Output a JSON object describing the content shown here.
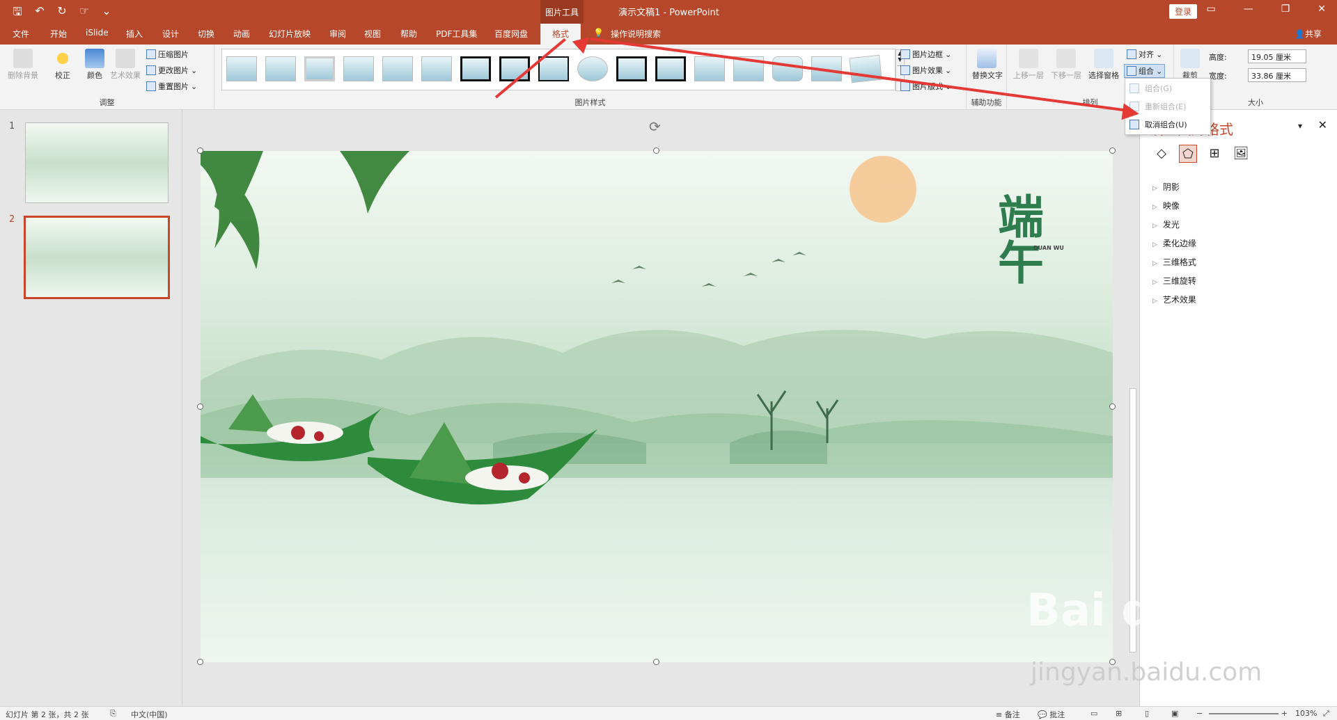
{
  "titlebar": {
    "context_group": "图片工具",
    "doc_title": "演示文稿1 - PowerPoint",
    "login": "登录",
    "qat_icons": [
      "save-icon",
      "undo-icon",
      "redo-icon",
      "touch-mode-icon",
      "customize-icon"
    ]
  },
  "tabs": [
    "文件",
    "开始",
    "iSlide",
    "插入",
    "设计",
    "切换",
    "动画",
    "幻灯片放映",
    "审阅",
    "视图",
    "帮助",
    "PDF工具集",
    "百度网盘",
    "格式"
  ],
  "active_tab": "格式",
  "search": "操作说明搜索",
  "share": "共享",
  "ribbon": {
    "adjust": {
      "remove_bg": "删除背景",
      "correct": "校正",
      "color": "颜色",
      "art": "艺术效果",
      "compress": "压缩图片",
      "change": "更改图片",
      "reset": "重置图片",
      "label": "调整"
    },
    "styles": {
      "label": "图片样式",
      "border": "图片边框",
      "effects": "图片效果",
      "layout": "图片版式"
    },
    "accessibility": {
      "alt_text": "替换文字",
      "label": "辅助功能"
    },
    "arrange": {
      "forward": "上移一层",
      "backward": "下移一层",
      "selection_pane": "选择窗格",
      "align": "对齐",
      "group": "组合",
      "label": "排列"
    },
    "size": {
      "crop": "裁剪",
      "height_label": "高度:",
      "height_value": "19.05 厘米",
      "width_label": "宽度:",
      "width_value": "33.86 厘米",
      "label": "大小"
    }
  },
  "group_menu": {
    "items": [
      {
        "label": "组合(G)",
        "enabled": false
      },
      {
        "label": "重新组合(E)",
        "enabled": false
      },
      {
        "label": "取消组合(U)",
        "enabled": true
      }
    ]
  },
  "slides": {
    "numbers": [
      "1",
      "2"
    ],
    "selected": "2"
  },
  "slide_content": {
    "title_art": "端午",
    "subtitle_art": "DUAN WU"
  },
  "format_pane": {
    "title": "设置图片格式",
    "items": [
      "阴影",
      "映像",
      "发光",
      "柔化边缘",
      "三维格式",
      "三维旋转",
      "艺术效果"
    ]
  },
  "statusbar": {
    "slide_info": "幻灯片 第 2 张，共 2 张",
    "language": "中文(中国)",
    "notes": "备注",
    "comments": "批注",
    "zoom": "103%"
  },
  "watermark": {
    "brand": "Bai du 经验",
    "url": "jingyan.baidu.com"
  },
  "colors": {
    "accent": "#b7472a",
    "arrow": "#e53935"
  }
}
